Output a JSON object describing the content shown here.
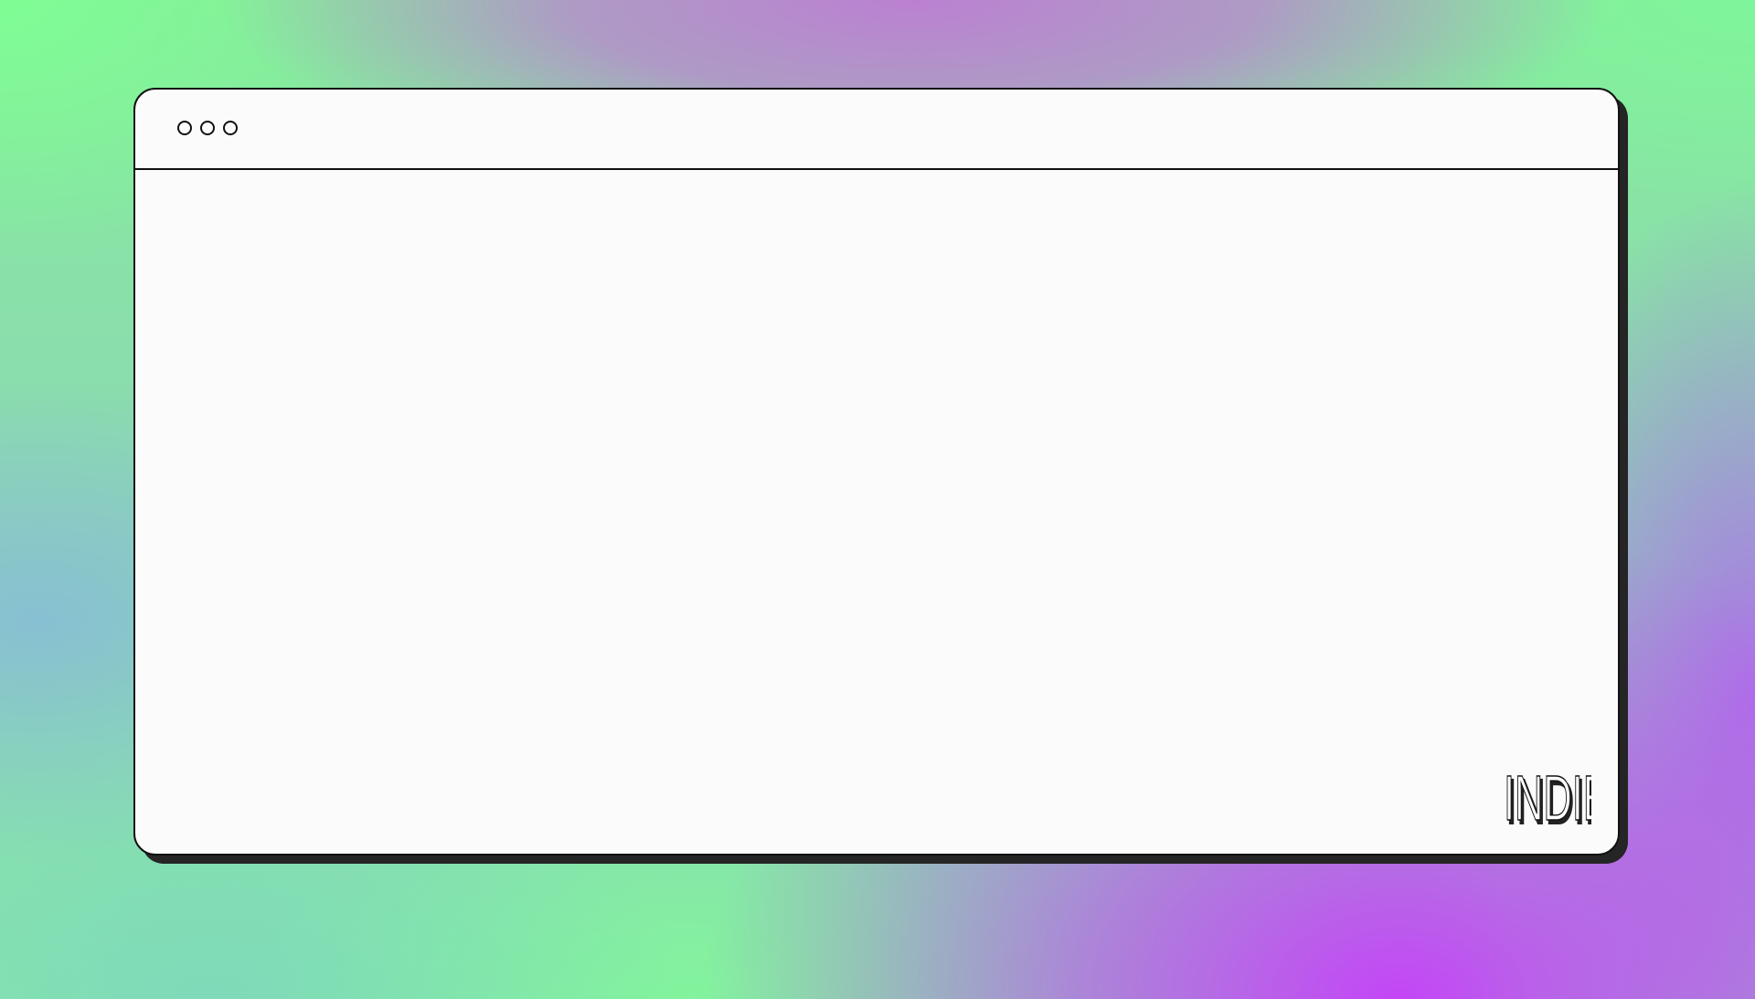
{
  "window": {
    "controls": [
      "window-control-1",
      "window-control-2",
      "window-control-3"
    ]
  },
  "brand": {
    "logo_text": "INDIE"
  },
  "colors": {
    "window_background": "#fbfbfb",
    "window_border": "#111111",
    "window_shadow": "#252525",
    "background_green": "#7ffd94",
    "background_purple": "#c542f8"
  }
}
